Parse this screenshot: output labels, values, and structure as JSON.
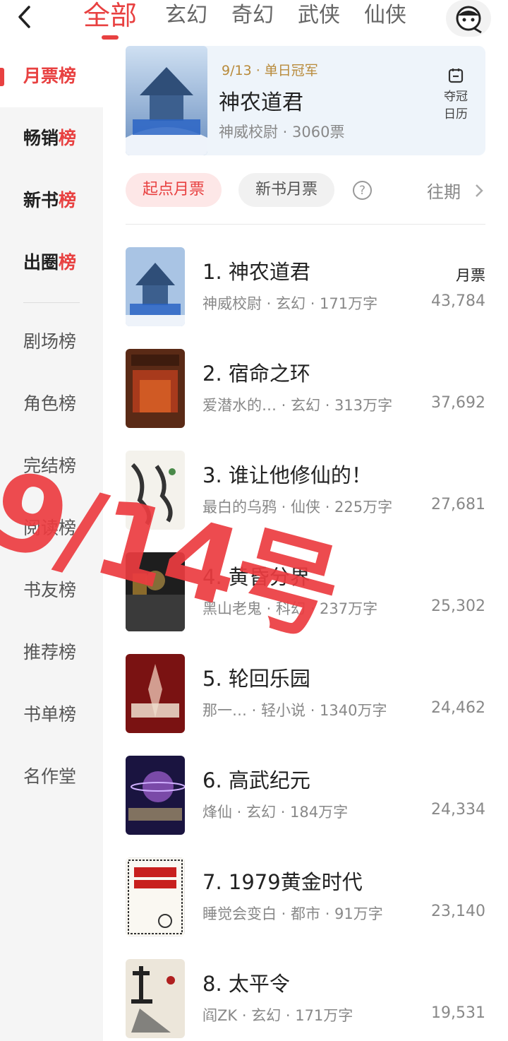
{
  "colors": {
    "accent": "#e84141",
    "sidebar_bg": "#f5f5f5",
    "champion_bg": "#eef4fa"
  },
  "header": {
    "back_icon": "chevron-left-icon",
    "tabs": [
      {
        "label": "全部",
        "active": true
      },
      {
        "label": "玄幻"
      },
      {
        "label": "奇幻"
      },
      {
        "label": "武侠"
      },
      {
        "label": "仙侠"
      }
    ],
    "avatar_icon": "user-avatar-icon"
  },
  "sidebar": {
    "items": [
      {
        "label": "月票",
        "tail": "榜",
        "active": true
      },
      {
        "label": "畅销",
        "tail": "榜"
      },
      {
        "label": "新书",
        "tail": "榜"
      },
      {
        "label": "出圈",
        "tail": "榜"
      },
      {
        "label": "剧场榜"
      },
      {
        "label": "角色榜"
      },
      {
        "label": "完结榜"
      },
      {
        "label": "阅读榜"
      },
      {
        "label": "书友榜"
      },
      {
        "label": "推荐榜"
      },
      {
        "label": "书单榜"
      },
      {
        "label": "名作堂"
      }
    ]
  },
  "champion": {
    "badge": "9/13 · 单日冠军",
    "title": "神农道君",
    "subtitle": "神威校尉 · 3060票",
    "calendar_line1": "夺冠",
    "calendar_line2": "日历"
  },
  "filters": {
    "qidian": "起点月票",
    "newbook": "新书月票",
    "help": "?",
    "past": "往期"
  },
  "list": {
    "votes_header": "月票",
    "rows": [
      {
        "title": "1. 神农道君",
        "meta": "神威校尉 · 玄幻 · 171万字",
        "votes": "43,784"
      },
      {
        "title": "2. 宿命之环",
        "meta": "爱潜水的… · 玄幻 · 313万字",
        "votes": "37,692"
      },
      {
        "title": "3. 谁让他修仙的！",
        "meta": "最白的乌鸦 · 仙侠 · 225万字",
        "votes": "27,681"
      },
      {
        "title": "4. 黄昏分界",
        "meta": "黑山老鬼 · 科幻 · 237万字",
        "votes": "25,302"
      },
      {
        "title": "5. 轮回乐园",
        "meta": "那一…  · 轻小说 · 1340万字",
        "votes": "24,462"
      },
      {
        "title": "6. 高武纪元",
        "meta": "烽仙 · 玄幻 · 184万字",
        "votes": "24,334"
      },
      {
        "title": "7. 1979黄金时代",
        "meta": "睡觉会变白 · 都市 · 91万字",
        "votes": "23,140"
      },
      {
        "title": "8. 太平令",
        "meta": "阎ZK · 玄幻 · 171万字",
        "votes": "19,531"
      }
    ]
  },
  "watermark": "9/14号"
}
